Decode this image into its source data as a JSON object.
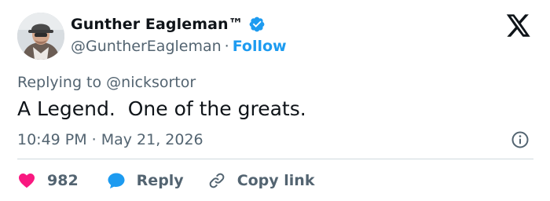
{
  "author": {
    "display_name": "Gunther Eagleman™",
    "handle": "@GuntherEagleman",
    "separator": "·",
    "follow_label": "Follow",
    "verified": true
  },
  "reply_context": {
    "prefix": "Replying to",
    "mention": "@nicksortor"
  },
  "tweet": {
    "text": "A Legend.  One of the greats.",
    "time": "10:49 PM",
    "date_separator": "·",
    "date": "May 21, 2026"
  },
  "actions": {
    "like_count": "982",
    "reply_label": "Reply",
    "copy_link_label": "Copy link"
  },
  "colors": {
    "accent": "#1d9bf0",
    "like": "#f91880",
    "text_primary": "#0f1419",
    "text_secondary": "#536471",
    "divider": "#cfd9de"
  },
  "icons": {
    "verified": "verified-badge-icon",
    "platform": "x-logo-icon",
    "info": "info-icon",
    "like": "heart-icon",
    "reply": "speech-bubble-icon",
    "copy": "link-icon"
  }
}
